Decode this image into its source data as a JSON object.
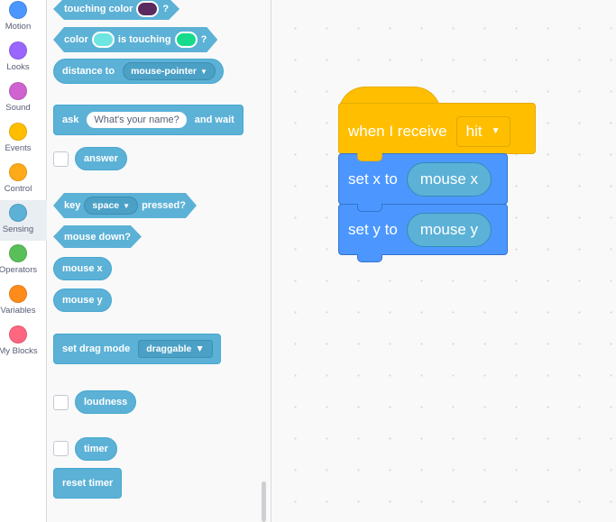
{
  "categories": [
    {
      "label": "Motion",
      "color": "#4c97ff"
    },
    {
      "label": "Looks",
      "color": "#9966ff"
    },
    {
      "label": "Sound",
      "color": "#cf63cf"
    },
    {
      "label": "Events",
      "color": "#ffbf00"
    },
    {
      "label": "Control",
      "color": "#ffab19"
    },
    {
      "label": "Sensing",
      "color": "#5cb1d6"
    },
    {
      "label": "Operators",
      "color": "#59c059"
    },
    {
      "label": "Variables",
      "color": "#ff8c1a"
    },
    {
      "label": "My Blocks",
      "color": "#ff6680"
    }
  ],
  "selected_category": "Sensing",
  "palette": {
    "touching_color": {
      "label": "touching color",
      "suffix": "?",
      "swatch": "#5b2a5e"
    },
    "color_touching": {
      "label1": "color",
      "label2": "is touching",
      "suffix": "?",
      "swatch1": "#6ee5e0",
      "swatch2": "#16db8c"
    },
    "distance_to": {
      "label": "distance to",
      "option": "mouse-pointer"
    },
    "ask": {
      "label": "ask",
      "input": "What's your name?",
      "label2": "and wait"
    },
    "answer": {
      "label": "answer"
    },
    "key_pressed": {
      "label1": "key",
      "option": "space",
      "label2": "pressed?"
    },
    "mouse_down": {
      "label": "mouse down?"
    },
    "mouse_x": {
      "label": "mouse x"
    },
    "mouse_y": {
      "label": "mouse y"
    },
    "set_drag_mode": {
      "label": "set drag mode",
      "option": "draggable"
    },
    "loudness": {
      "label": "loudness"
    },
    "timer": {
      "label": "timer"
    },
    "reset_timer": {
      "label": "reset timer"
    }
  },
  "script": {
    "hat": {
      "label": "when I receive",
      "option": "hit"
    },
    "set_x": {
      "label": "set x to",
      "value": "mouse x"
    },
    "set_y": {
      "label": "set y to",
      "value": "mouse y"
    }
  }
}
